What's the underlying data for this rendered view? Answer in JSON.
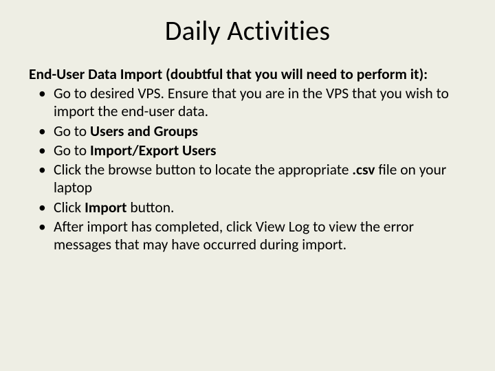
{
  "title": "Daily Activities",
  "lead": "End-User Data Import (doubtful that you will need to perform it):",
  "items": [
    {
      "pre": "Go to desired VPS.  Ensure that you are in the VPS that you wish to import the end-user data.",
      "bold": "",
      "post": ""
    },
    {
      "pre": "Go to ",
      "bold": "Users and Groups",
      "post": ""
    },
    {
      "pre": "Go to ",
      "bold": "Import/Export Users",
      "post": ""
    },
    {
      "pre": "Click the browse button to locate the appropriate ",
      "bold": ".csv",
      "post": " file on your laptop"
    },
    {
      "pre": "Click ",
      "bold": "Import",
      "post": " button."
    },
    {
      "pre": "After import has completed, click View Log to view the error messages that may have occurred during import.",
      "bold": "",
      "post": ""
    }
  ]
}
